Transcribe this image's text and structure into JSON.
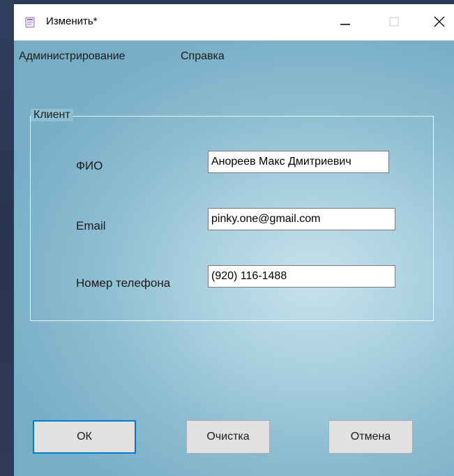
{
  "window": {
    "title": "Изменить*",
    "icon": "app-icon"
  },
  "menu": {
    "items": [
      {
        "label": "Администрирование"
      },
      {
        "label": "Справка"
      }
    ]
  },
  "group": {
    "title": "Клиент",
    "fields": {
      "fio": {
        "label": "ФИО",
        "value": "Анореев Макс Дмитриевич"
      },
      "email": {
        "label": "Email",
        "value": "pinky.one@gmail.com"
      },
      "phone": {
        "label": "Номер телефона",
        "value": "(920) 116-1488"
      }
    }
  },
  "buttons": {
    "ok": "ОК",
    "clear": "Очистка",
    "cancel": "Отмена"
  },
  "colors": {
    "focus_border": "#0078d7",
    "button_face": "#e1e1e1"
  }
}
